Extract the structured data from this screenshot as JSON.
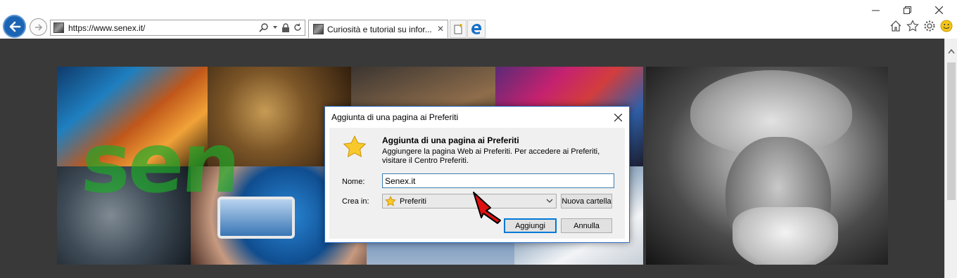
{
  "browser": {
    "url": "https://www.senex.it/",
    "tab_title": "Curiosità e tutorial su infor...",
    "tab_close": "✕"
  },
  "dialog": {
    "title": "Aggiunta di una pagina ai Preferiti",
    "heading": "Aggiunta di una pagina ai Preferiti",
    "description": "Aggiungere la pagina Web ai Preferiti. Per accedere ai Preferiti, visitare il Centro Preferiti.",
    "name_label": "Nome:",
    "name_value": "Senex.it",
    "create_in_label": "Crea in:",
    "create_in_value": "Preferiti",
    "new_folder_button": "Nuova cartella",
    "add_button": "Aggiungi",
    "cancel_button": "Annulla"
  },
  "banner": {
    "logo_text": "sen"
  },
  "colors": {
    "accent": "#0078d7",
    "back_button": "#1b64b4",
    "page_background": "#393939"
  },
  "icons": [
    "back-arrow-icon",
    "forward-arrow-icon",
    "search-icon",
    "lock-icon",
    "refresh-icon",
    "new-tab-icon",
    "edge-icon",
    "home-icon",
    "favorites-star-icon",
    "settings-gear-icon",
    "smiley-icon",
    "minimize-icon",
    "restore-icon",
    "close-icon"
  ]
}
